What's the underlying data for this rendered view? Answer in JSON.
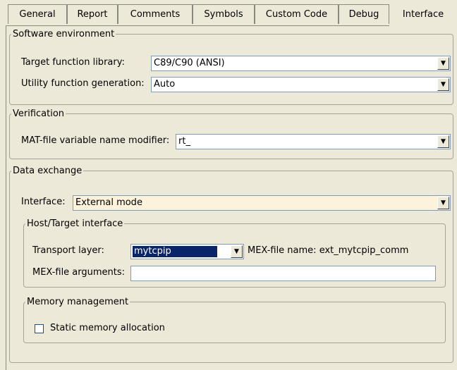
{
  "tabs": [
    {
      "label": "General"
    },
    {
      "label": "Report"
    },
    {
      "label": "Comments"
    },
    {
      "label": "Symbols"
    },
    {
      "label": "Custom Code"
    },
    {
      "label": "Debug"
    },
    {
      "label": "Interface"
    }
  ],
  "active_tab": "Interface",
  "software_env": {
    "title": "Software environment",
    "tfl_label": "Target function library:",
    "tfl_value": "C89/C90 (ANSI)",
    "ufg_label": "Utility function generation:",
    "ufg_value": "Auto"
  },
  "verification": {
    "title": "Verification",
    "mat_label": "MAT-file variable name modifier:",
    "mat_value": "rt_"
  },
  "data_exchange": {
    "title": "Data exchange",
    "interface_label": "Interface:",
    "interface_value": "External mode",
    "host_target": {
      "title": "Host/Target interface",
      "transport_label": "Transport layer:",
      "transport_value": "mytcpip",
      "mex_name_label": "MEX-file name:",
      "mex_name_value": "ext_mytcpip_comm",
      "mex_args_label": "MEX-file arguments:",
      "mex_args_value": ""
    },
    "memory": {
      "title": "Memory management",
      "static_label": "Static memory allocation",
      "static_checked": false
    }
  },
  "colors": {
    "background": "#ece9d8",
    "field_border": "#7f9db9",
    "selection": "#0a246a",
    "interface_field": "#fdf3dc"
  },
  "icons": {
    "dropdown": "triangle-down"
  }
}
